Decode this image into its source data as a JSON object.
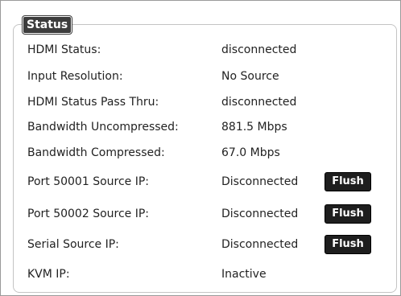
{
  "status": {
    "title": "Status",
    "rows": [
      {
        "label": "HDMI Status:",
        "value": "disconnected"
      },
      {
        "label": "Input Resolution:",
        "value": "No Source"
      },
      {
        "label": "HDMI Status Pass Thru:",
        "value": "disconnected"
      },
      {
        "label": "Bandwidth Uncompressed:",
        "value": "881.5 Mbps"
      },
      {
        "label": "Bandwidth Compressed:",
        "value": "67.0 Mbps"
      },
      {
        "label": "Port 50001 Source IP:",
        "value": "Disconnected",
        "button": "Flush"
      },
      {
        "label": "Port 50002 Source IP:",
        "value": "Disconnected",
        "button": "Flush"
      },
      {
        "label": "Serial Source IP:",
        "value": "Disconnected",
        "button": "Flush"
      },
      {
        "label": "KVM IP:",
        "value": "Inactive"
      }
    ]
  }
}
